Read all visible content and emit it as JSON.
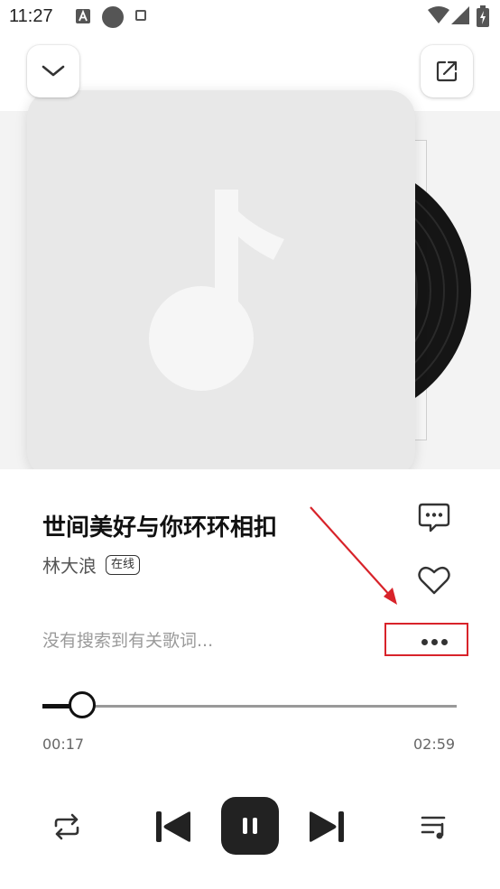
{
  "status_bar": {
    "time": "11:27",
    "icons": [
      "accessibility-a-icon",
      "circle-icon",
      "square-icon",
      "wifi-icon",
      "signal-icon",
      "battery-icon"
    ]
  },
  "top_bar": {
    "collapse_icon": "chevron-down-icon",
    "share_icon": "share-icon"
  },
  "song": {
    "title": "世间美好与你环环相扣",
    "artist": "林大浪",
    "source_badge": "在线"
  },
  "actions": {
    "comment_icon": "comment-icon",
    "like_icon": "heart-icon",
    "more_icon": "more-dots-icon"
  },
  "lyrics": {
    "placeholder": "没有搜索到有关歌词..."
  },
  "progress": {
    "current": "00:17",
    "total": "02:59",
    "fraction": 0.095
  },
  "controls": {
    "repeat_icon": "repeat-icon",
    "prev_icon": "skip-previous-icon",
    "play_state_icon": "pause-icon",
    "next_icon": "skip-next-icon",
    "playlist_icon": "playlist-icon"
  },
  "colors": {
    "annotation_red": "#d8232a",
    "control_dark": "#222222",
    "secondary_text": "#9a9a9a"
  }
}
